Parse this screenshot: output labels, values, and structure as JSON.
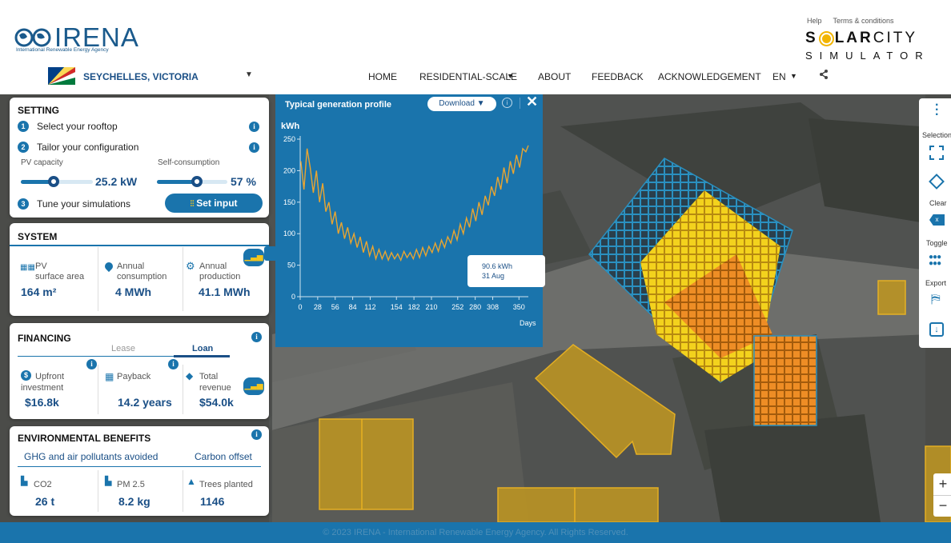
{
  "header": {
    "org_name": "IRENA",
    "org_sub": "International Renewable Energy Agency",
    "help": "Help",
    "terms": "Terms & conditions",
    "brand_line1_a": "S",
    "brand_line1_b": "LAR",
    "brand_line1_c": "CITY",
    "brand_line2": "SIMULATOR",
    "country": "SEYCHELLES, VICTORIA",
    "nav": [
      "HOME",
      "RESIDENTIAL-SCALE",
      "ABOUT",
      "FEEDBACK",
      "ACKNOWLEDGEMENT",
      "EN"
    ]
  },
  "setting": {
    "title": "SETTING",
    "step1": "Select your rooftop",
    "step2": "Tailor your configuration",
    "pv_label": "PV capacity",
    "pv_value": "25.2 kW",
    "pv_fraction": 0.45,
    "self_label": "Self-consumption",
    "self_value": "57 %",
    "self_fraction": 0.57,
    "step3": "Tune your simulations",
    "set_input": "Set input"
  },
  "system": {
    "title": "SYSTEM",
    "pv_l1": "PV",
    "pv_l2": "surface area",
    "pv_val": "164 m²",
    "cons_l1": "Annual",
    "cons_l2": "consumption",
    "cons_val": "4 MWh",
    "prod_l1": "Annual",
    "prod_l2": "production",
    "prod_val": "41.1 MWh"
  },
  "financing": {
    "title": "FINANCING",
    "tab_lease": "Lease",
    "tab_loan": "Loan",
    "up_l1": "Upfront",
    "up_l2": "investment",
    "up_val": "$16.8k",
    "pay_l1": "Payback",
    "pay_val": "14.2 years",
    "rev_l1": "Total",
    "rev_l2": "revenue",
    "rev_val": "$54.0k"
  },
  "environment": {
    "title": "ENVIRONMENTAL BENEFITS",
    "sub1": "GHG and air pollutants avoided",
    "sub2": "Carbon offset",
    "co2_l": "CO2",
    "co2_v": "26 t",
    "pm_l": "PM 2.5",
    "pm_v": "8.2 kg",
    "trees_l": "Trees planted",
    "trees_v": "1146"
  },
  "generation": {
    "title": "Typical generation profile",
    "download": "Download",
    "unit": "kWh",
    "x_unit": "Days",
    "tooltip_val": "90.6 kWh",
    "tooltip_date": "31 Aug"
  },
  "chart_data": {
    "type": "line",
    "ylabel": "kWh",
    "xlabel": "Days",
    "ylim": [
      0,
      250
    ],
    "xlim": [
      0,
      365
    ],
    "y_ticks": [
      0,
      50,
      100,
      150,
      200,
      250
    ],
    "x_ticks": [
      0,
      28,
      56,
      84,
      112,
      154,
      182,
      210,
      252,
      280,
      308,
      350
    ],
    "series": [
      {
        "color": "#e9a531",
        "x": [
          1,
          6,
          11,
          16,
          21,
          26,
          31,
          36,
          41,
          46,
          51,
          56,
          61,
          66,
          71,
          76,
          81,
          86,
          91,
          96,
          101,
          106,
          111,
          116,
          121,
          126,
          131,
          136,
          141,
          146,
          151,
          156,
          161,
          166,
          171,
          176,
          181,
          186,
          191,
          196,
          201,
          206,
          211,
          216,
          221,
          226,
          231,
          236,
          241,
          246,
          251,
          256,
          261,
          266,
          271,
          276,
          281,
          286,
          291,
          296,
          301,
          306,
          311,
          316,
          321,
          326,
          331,
          336,
          341,
          346,
          351,
          356,
          361,
          365
        ],
        "y": [
          215,
          170,
          235,
          205,
          165,
          200,
          150,
          180,
          135,
          150,
          115,
          135,
          100,
          118,
          92,
          110,
          85,
          100,
          78,
          95,
          70,
          88,
          65,
          80,
          60,
          75,
          60,
          72,
          58,
          70,
          60,
          68,
          58,
          72,
          62,
          70,
          60,
          75,
          62,
          78,
          65,
          80,
          70,
          85,
          72,
          90,
          78,
          95,
          85,
          105,
          90,
          115,
          100,
          125,
          110,
          140,
          120,
          150,
          130,
          160,
          145,
          175,
          160,
          190,
          170,
          205,
          180,
          215,
          195,
          225,
          205,
          235,
          230,
          240
        ]
      }
    ]
  },
  "right_bar": {
    "selection": "Selection",
    "clear": "Clear",
    "toggle": "Toggle",
    "export": "Export"
  },
  "footer": "© 2023 IRENA - International Renewable Energy Agency. All Rights Reserved."
}
